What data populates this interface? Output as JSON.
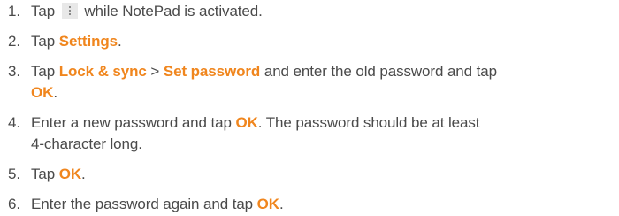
{
  "steps": [
    {
      "number": "1.",
      "pre": "Tap",
      "icon": "vertical-ellipsis-menu-icon",
      "post": "while NotePad is activated."
    },
    {
      "number": "2.",
      "pre": "Tap ",
      "hl1": "Settings",
      "post": "."
    },
    {
      "number": "3.",
      "pre": "Tap ",
      "hl1": "Lock & sync",
      "mid": " > ",
      "hl2": "Set password",
      "mid2": " and enter the old password and tap",
      "hl3": "OK",
      "post": "."
    },
    {
      "number": "4.",
      "pre": "Enter a new password and tap ",
      "hl1": "OK",
      "mid": ". The password should be at least",
      "post": "4-character long."
    },
    {
      "number": "5.",
      "pre": "Tap ",
      "hl1": "OK",
      "post": "."
    },
    {
      "number": "6.",
      "pre": "Enter the password again and tap ",
      "hl1": "OK",
      "post": "."
    }
  ],
  "colors": {
    "text": "#4a4a4a",
    "accent": "#f0861e"
  }
}
